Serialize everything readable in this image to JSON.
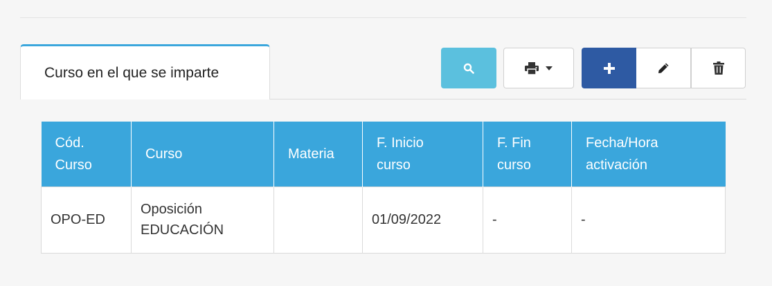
{
  "tab": {
    "label": "Curso en el que se imparte"
  },
  "toolbar": {
    "search_icon": "search-icon",
    "print_icon": "print-icon",
    "add_icon": "plus-icon",
    "edit_icon": "pencil-icon",
    "delete_icon": "trash-icon"
  },
  "colors": {
    "accent": "#3aa6dc",
    "search_button": "#5bc0de",
    "add_button": "#2e5aa3"
  },
  "table": {
    "headers": [
      "Cód.\nCurso",
      "Curso",
      "Materia",
      "F. Inicio\ncurso",
      "F. Fin\ncurso",
      "Fecha/Hora\nactivación"
    ],
    "rows": [
      {
        "cod_curso": "OPO-ED",
        "curso": "Oposición\nEDUCACIÓN",
        "materia": "",
        "f_inicio": "01/09/2022",
        "f_fin": "-",
        "fecha_activacion": "-"
      }
    ]
  }
}
